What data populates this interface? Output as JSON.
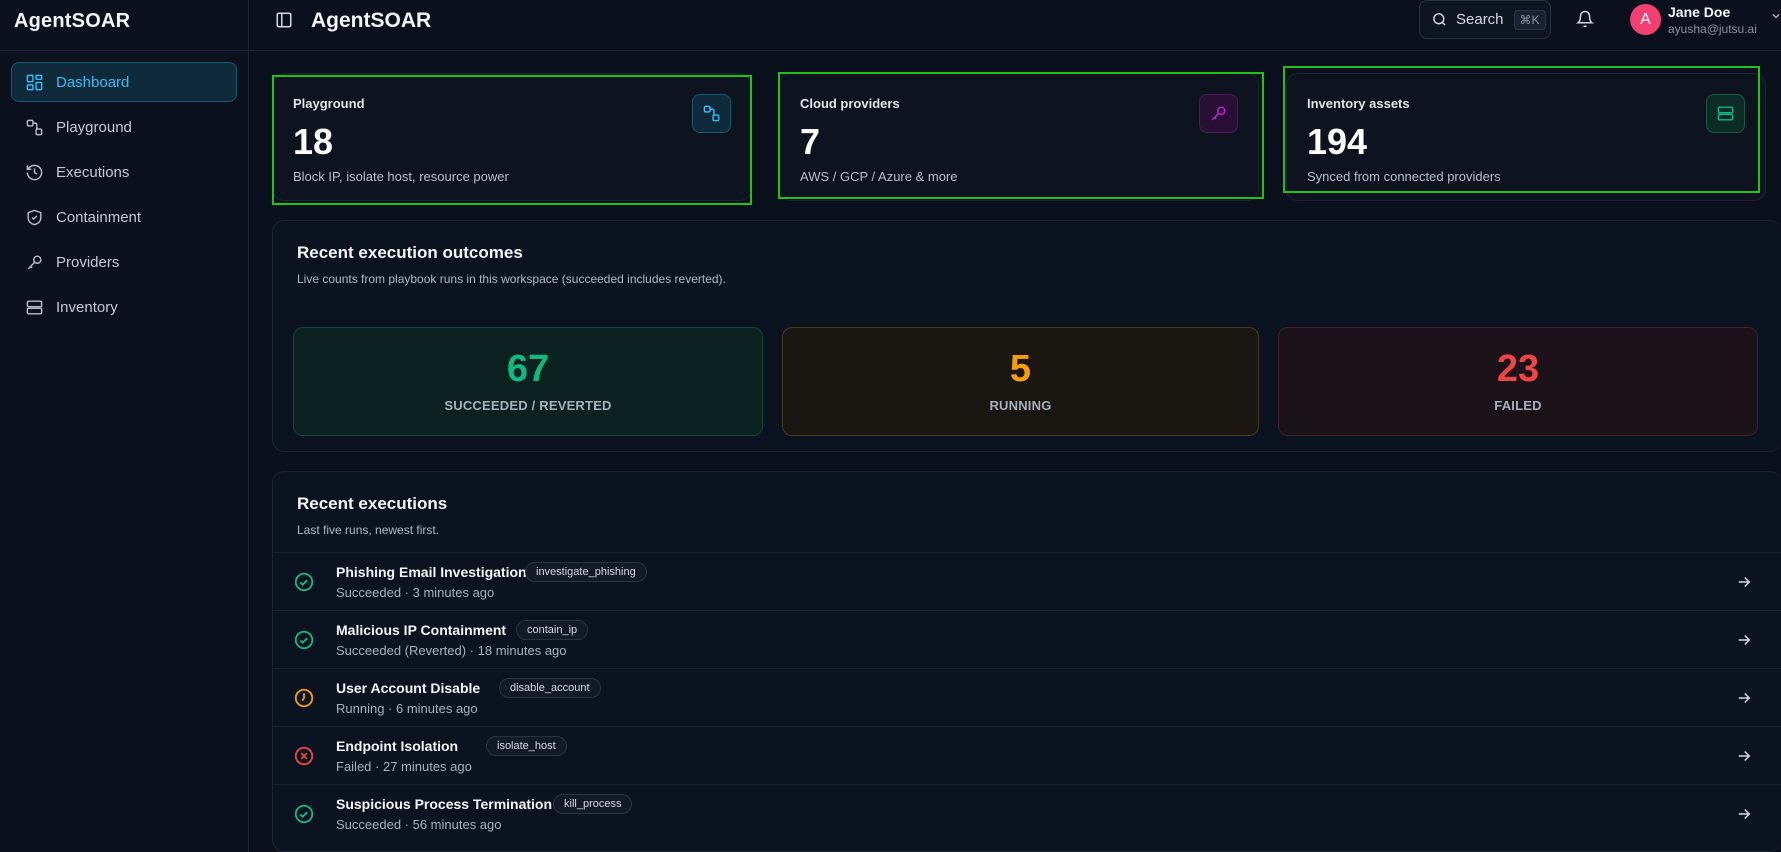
{
  "app": {
    "name": "AgentSOAR"
  },
  "sidebar": {
    "items": [
      {
        "label": "Dashboard",
        "icon": "dashboard-grid-icon",
        "active": true
      },
      {
        "label": "Playground",
        "icon": "workflow-icon",
        "active": false
      },
      {
        "label": "Executions",
        "icon": "history-icon",
        "active": false
      },
      {
        "label": "Containment",
        "icon": "shield-icon",
        "active": false
      },
      {
        "label": "Providers",
        "icon": "key-icon",
        "active": false
      },
      {
        "label": "Inventory",
        "icon": "server-icon",
        "active": false
      }
    ]
  },
  "header": {
    "title": "AgentSOAR",
    "search_label": "Search",
    "search_shortcut": "⌘K",
    "user": {
      "initial": "A",
      "name": "Jane Doe",
      "email": "ayusha@jutsu.ai"
    }
  },
  "stats": [
    {
      "label": "Playground",
      "value": "18",
      "desc": "Block IP, isolate host, resource power",
      "icon": "workflow-icon",
      "color": "#38bdf8"
    },
    {
      "label": "Cloud providers",
      "value": "7",
      "desc": "AWS / GCP / Azure & more",
      "icon": "key-icon",
      "color": "#c026d3"
    },
    {
      "label": "Inventory assets",
      "value": "194",
      "desc": "Synced from connected providers",
      "icon": "server-icon",
      "color": "#10b981"
    }
  ],
  "outcomes": {
    "title": "Recent execution outcomes",
    "subtitle": "Live counts from playbook runs in this workspace (succeeded includes reverted).",
    "items": [
      {
        "value": "67",
        "label": "SUCCEEDED / REVERTED",
        "color": "#10b981"
      },
      {
        "value": "5",
        "label": "RUNNING",
        "color": "#f59e0b"
      },
      {
        "value": "23",
        "label": "FAILED",
        "color": "#ef4444"
      }
    ]
  },
  "executions": {
    "title": "Recent executions",
    "subtitle": "Last five runs, newest first.",
    "rows": [
      {
        "name": "Phishing Email Investigation",
        "tag": "investigate_phishing",
        "meta": "Succeeded · 3 minutes ago",
        "status": "success"
      },
      {
        "name": "Malicious IP Containment",
        "tag": "contain_ip",
        "meta": "Succeeded (Reverted) · 18 minutes ago",
        "status": "success"
      },
      {
        "name": "User Account Disable",
        "tag": "disable_account",
        "meta": "Running · 6 minutes ago",
        "status": "running"
      },
      {
        "name": "Endpoint Isolation",
        "tag": "isolate_host",
        "meta": "Failed · 27 minutes ago",
        "status": "failed"
      },
      {
        "name": "Suspicious Process Termination",
        "tag": "kill_process",
        "meta": "Succeeded · 56 minutes ago",
        "status": "success"
      }
    ]
  }
}
